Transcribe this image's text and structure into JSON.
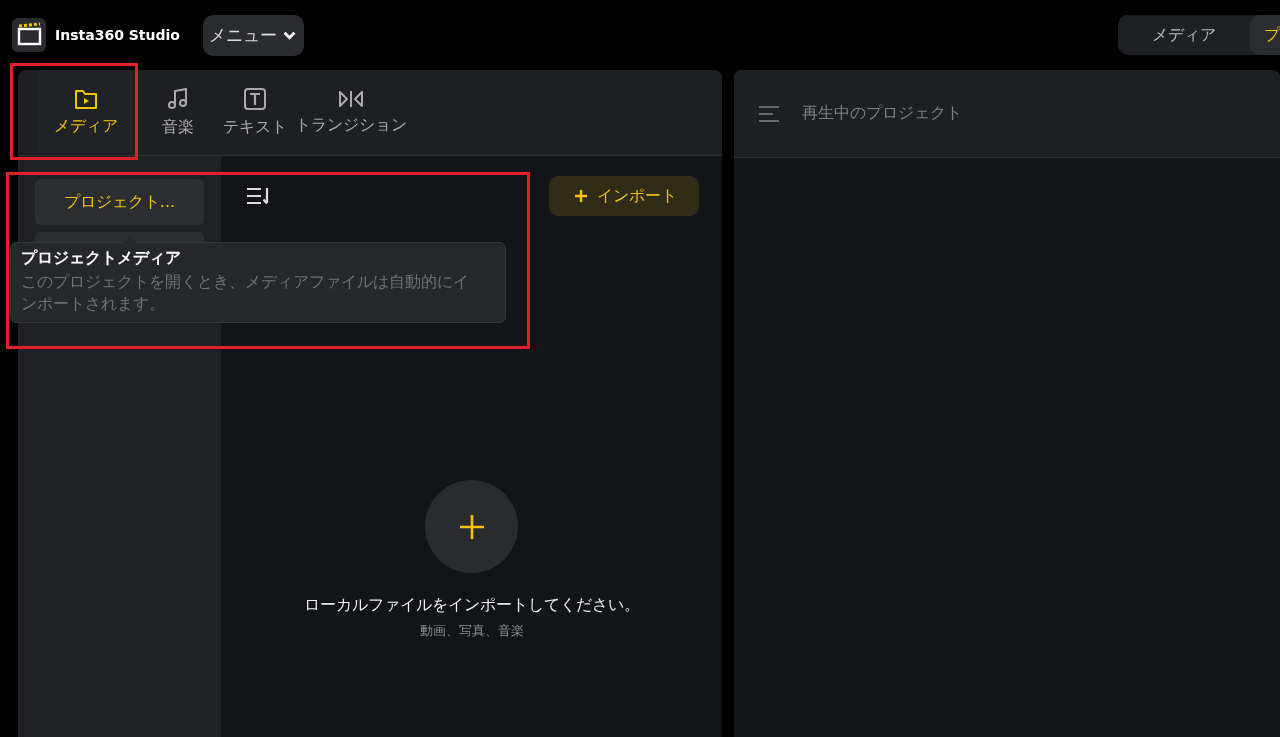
{
  "app": {
    "title": "Insta360 Studio",
    "menu": "メニュー"
  },
  "view_switch": [
    {
      "label": "メディア",
      "selected": false
    },
    {
      "label": "プ",
      "selected": true
    }
  ],
  "tabs": [
    {
      "kind": "folder",
      "label": "メディア",
      "selected": true
    },
    {
      "kind": "music",
      "label": "音楽",
      "selected": false
    },
    {
      "kind": "text",
      "label": "テキスト",
      "selected": false
    },
    {
      "kind": "transition",
      "label": "トランジション",
      "selected": false
    }
  ],
  "sidebar": {
    "items": [
      {
        "label": "プロジェクト...",
        "selected": true
      }
    ]
  },
  "tooltip": {
    "title": "プロジェクトメディア",
    "text": "このプロジェクトを開くとき、メディアファイルは自動的にインポートされます。"
  },
  "import_button": {
    "label": "インポート"
  },
  "empty_state": {
    "message": "ローカルファイルをインポートしてください。",
    "hint": "動画、写真、音楽"
  },
  "player": {
    "title": "再生中のプロジェクト"
  }
}
